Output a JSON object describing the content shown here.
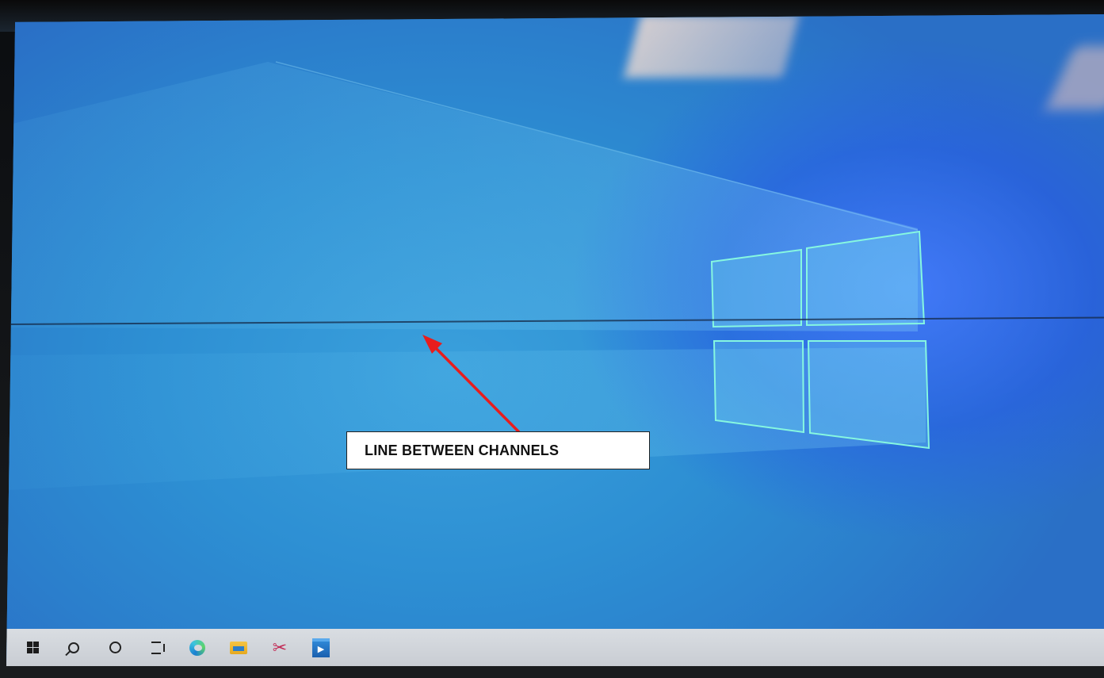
{
  "annotation": {
    "label": "LINE BETWEEN CHANNELS",
    "arrow_color": "#e81d1d"
  },
  "desktop": {
    "wallpaper": "windows-10-hero-blue",
    "accent": "#2a7ccd",
    "logo_color": "#7ef0d8"
  },
  "taskbar": {
    "background": "#d4d8dd",
    "icons": [
      {
        "name": "windows-start-icon"
      },
      {
        "name": "search-icon"
      },
      {
        "name": "cortana-icon"
      },
      {
        "name": "task-view-icon"
      },
      {
        "name": "edge-browser-icon"
      },
      {
        "name": "file-explorer-icon"
      },
      {
        "name": "snipping-tool-icon"
      },
      {
        "name": "media-player-icon"
      }
    ]
  }
}
